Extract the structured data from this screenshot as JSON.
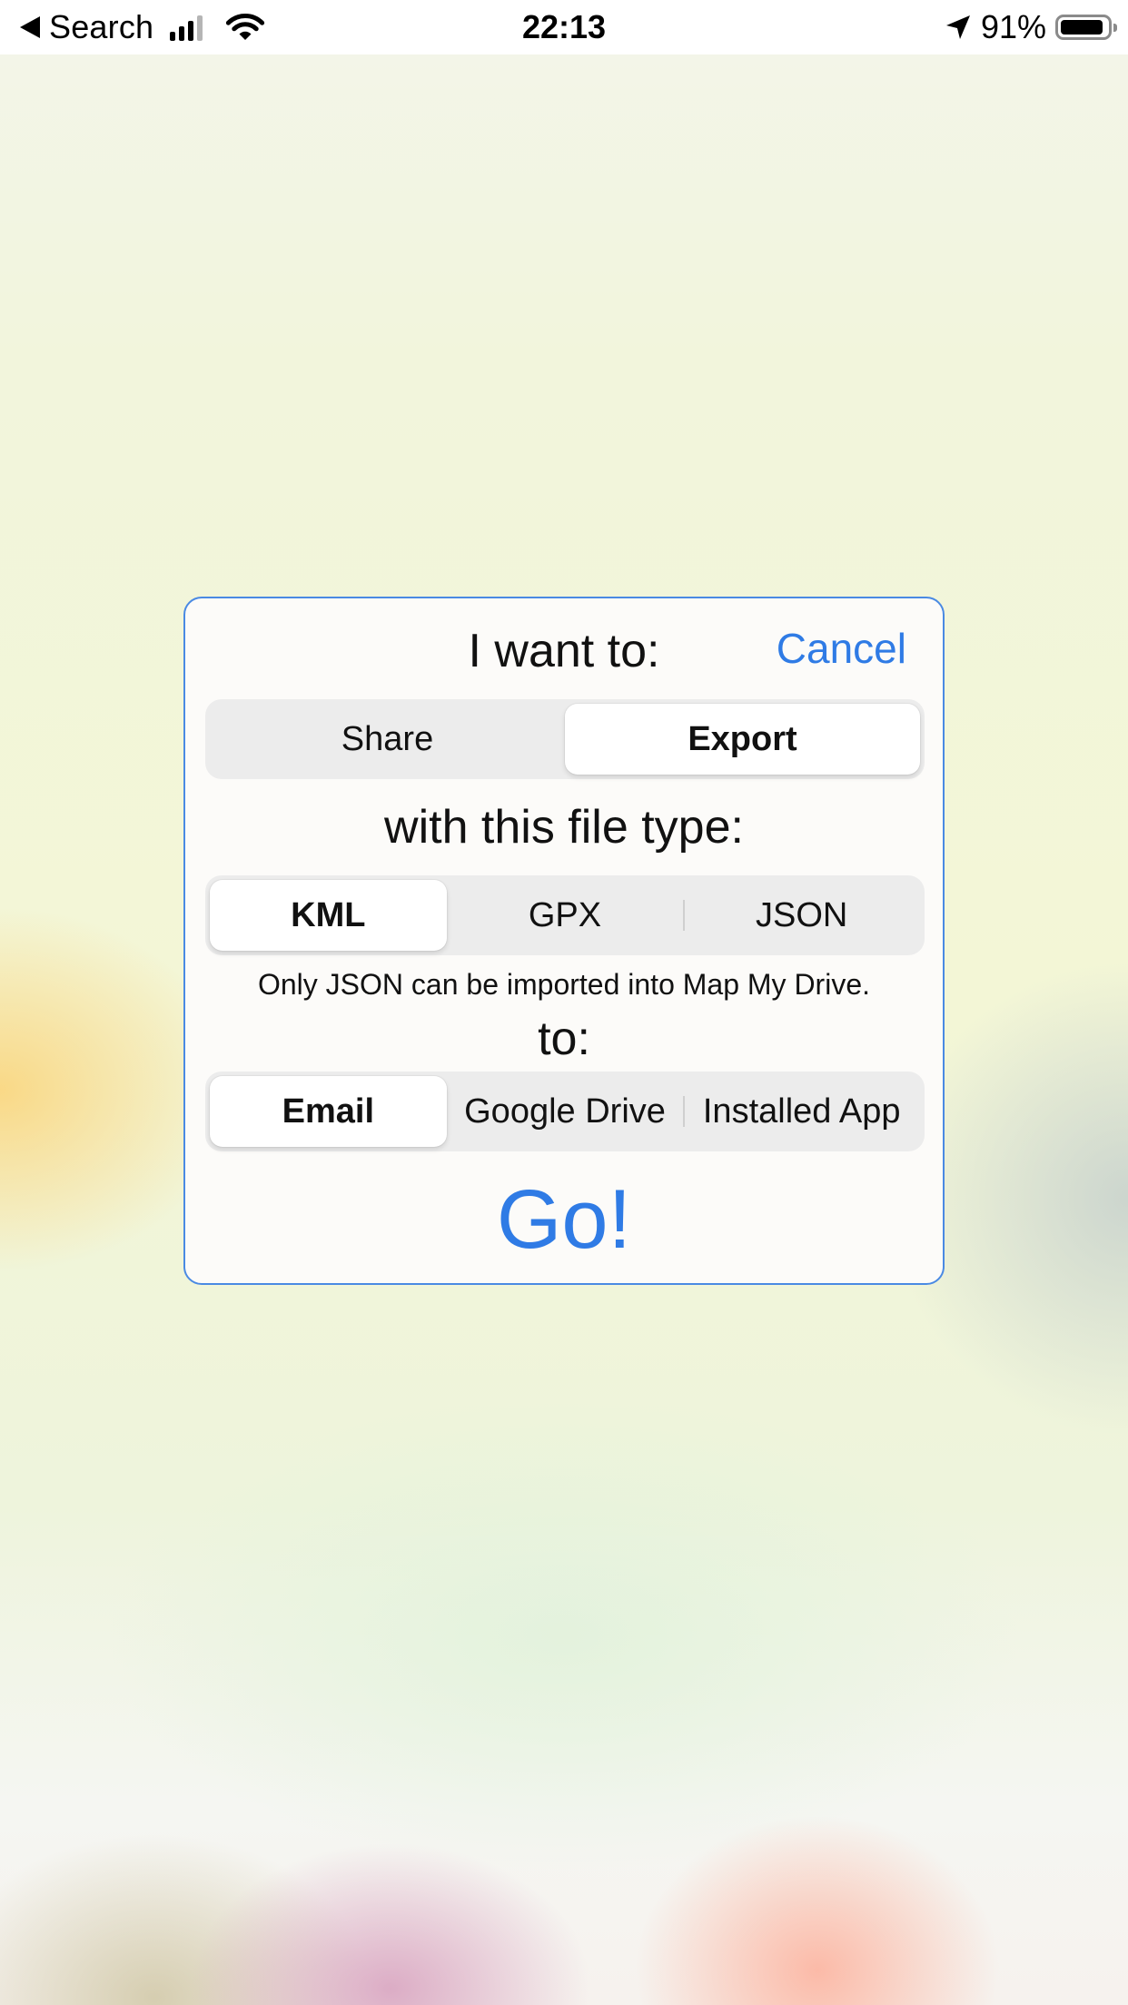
{
  "status_bar": {
    "back_label": "Search",
    "time": "22:13",
    "battery_percent": "91%",
    "battery_level": 0.91
  },
  "dialog": {
    "title": "I want to:",
    "cancel_label": "Cancel",
    "action_segments": [
      {
        "label": "Share",
        "selected": false
      },
      {
        "label": "Export",
        "selected": true
      }
    ],
    "file_type_heading": "with this file type:",
    "file_type_segments": [
      {
        "label": "KML",
        "selected": true
      },
      {
        "label": "GPX",
        "selected": false
      },
      {
        "label": "JSON",
        "selected": false
      }
    ],
    "note": "Only JSON can be imported into Map My Drive.",
    "destination_heading": "to:",
    "destination_segments": [
      {
        "label": "Email",
        "selected": true
      },
      {
        "label": "Google Drive",
        "selected": false
      },
      {
        "label": "Installed App",
        "selected": false
      }
    ],
    "go_label": "Go!"
  },
  "colors": {
    "accent": "#2f7be5",
    "dialog_border": "#4a8ae3",
    "segment_background": "#ececec"
  }
}
